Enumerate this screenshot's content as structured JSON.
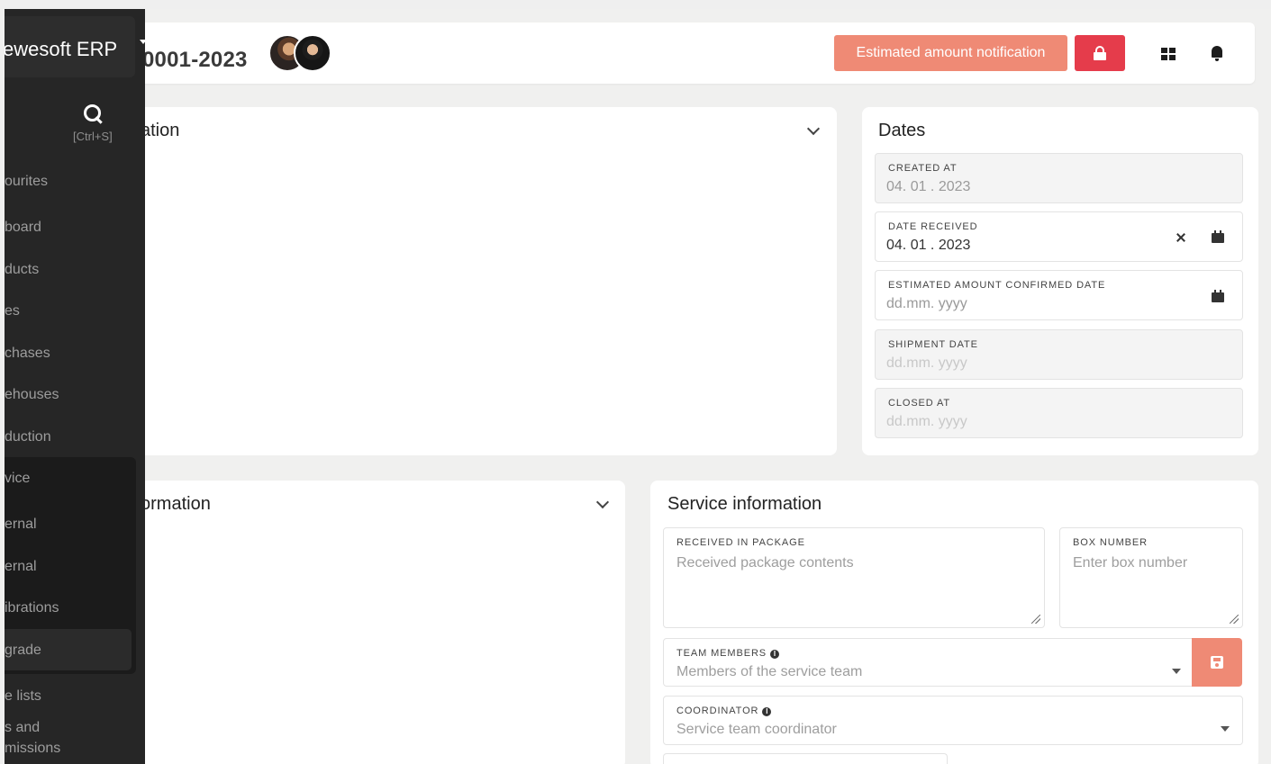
{
  "header": {
    "doc_title": "0001-2023",
    "notify_label": "Estimated amount notification"
  },
  "sidebar": {
    "brand": "ewesoft ERP",
    "shortcut": "[Ctrl+S]",
    "items": [
      "ourites",
      "board",
      "ducts",
      "es",
      "chases",
      "ehouses",
      "duction",
      "vice",
      "ernal",
      "ernal",
      "ibrations",
      "grade",
      "e lists",
      "s and",
      "missions"
    ]
  },
  "cards": {
    "info_title": "ation",
    "info2_title": "ormation",
    "dates": {
      "title": "Dates",
      "created_label": "CREATED AT",
      "created_value": "04. 01 . 2023",
      "received_label": "DATE RECEIVED",
      "received_value": "04. 01 . 2023",
      "confirmed_label": "ESTIMATED AMOUNT CONFIRMED DATE",
      "confirmed_value": "dd.mm. yyyy",
      "shipment_label": "SHIPMENT DATE",
      "shipment_value": "dd.mm. yyyy",
      "closed_label": "CLOSED AT",
      "closed_value": "dd.mm. yyyy"
    },
    "service": {
      "title": "Service information",
      "package_label": "RECEIVED IN PACKAGE",
      "package_placeholder": "Received package contents",
      "box_label": "BOX NUMBER",
      "box_placeholder": "Enter box number",
      "team_label": "TEAM MEMBERS",
      "team_placeholder": "Members of the service team",
      "coord_label": "COORDINATOR",
      "coord_placeholder": "Service team coordinator"
    }
  },
  "colors": {
    "accent": "#ef8a75",
    "danger": "#e53c4b",
    "sidebar_bg": "#262626"
  }
}
